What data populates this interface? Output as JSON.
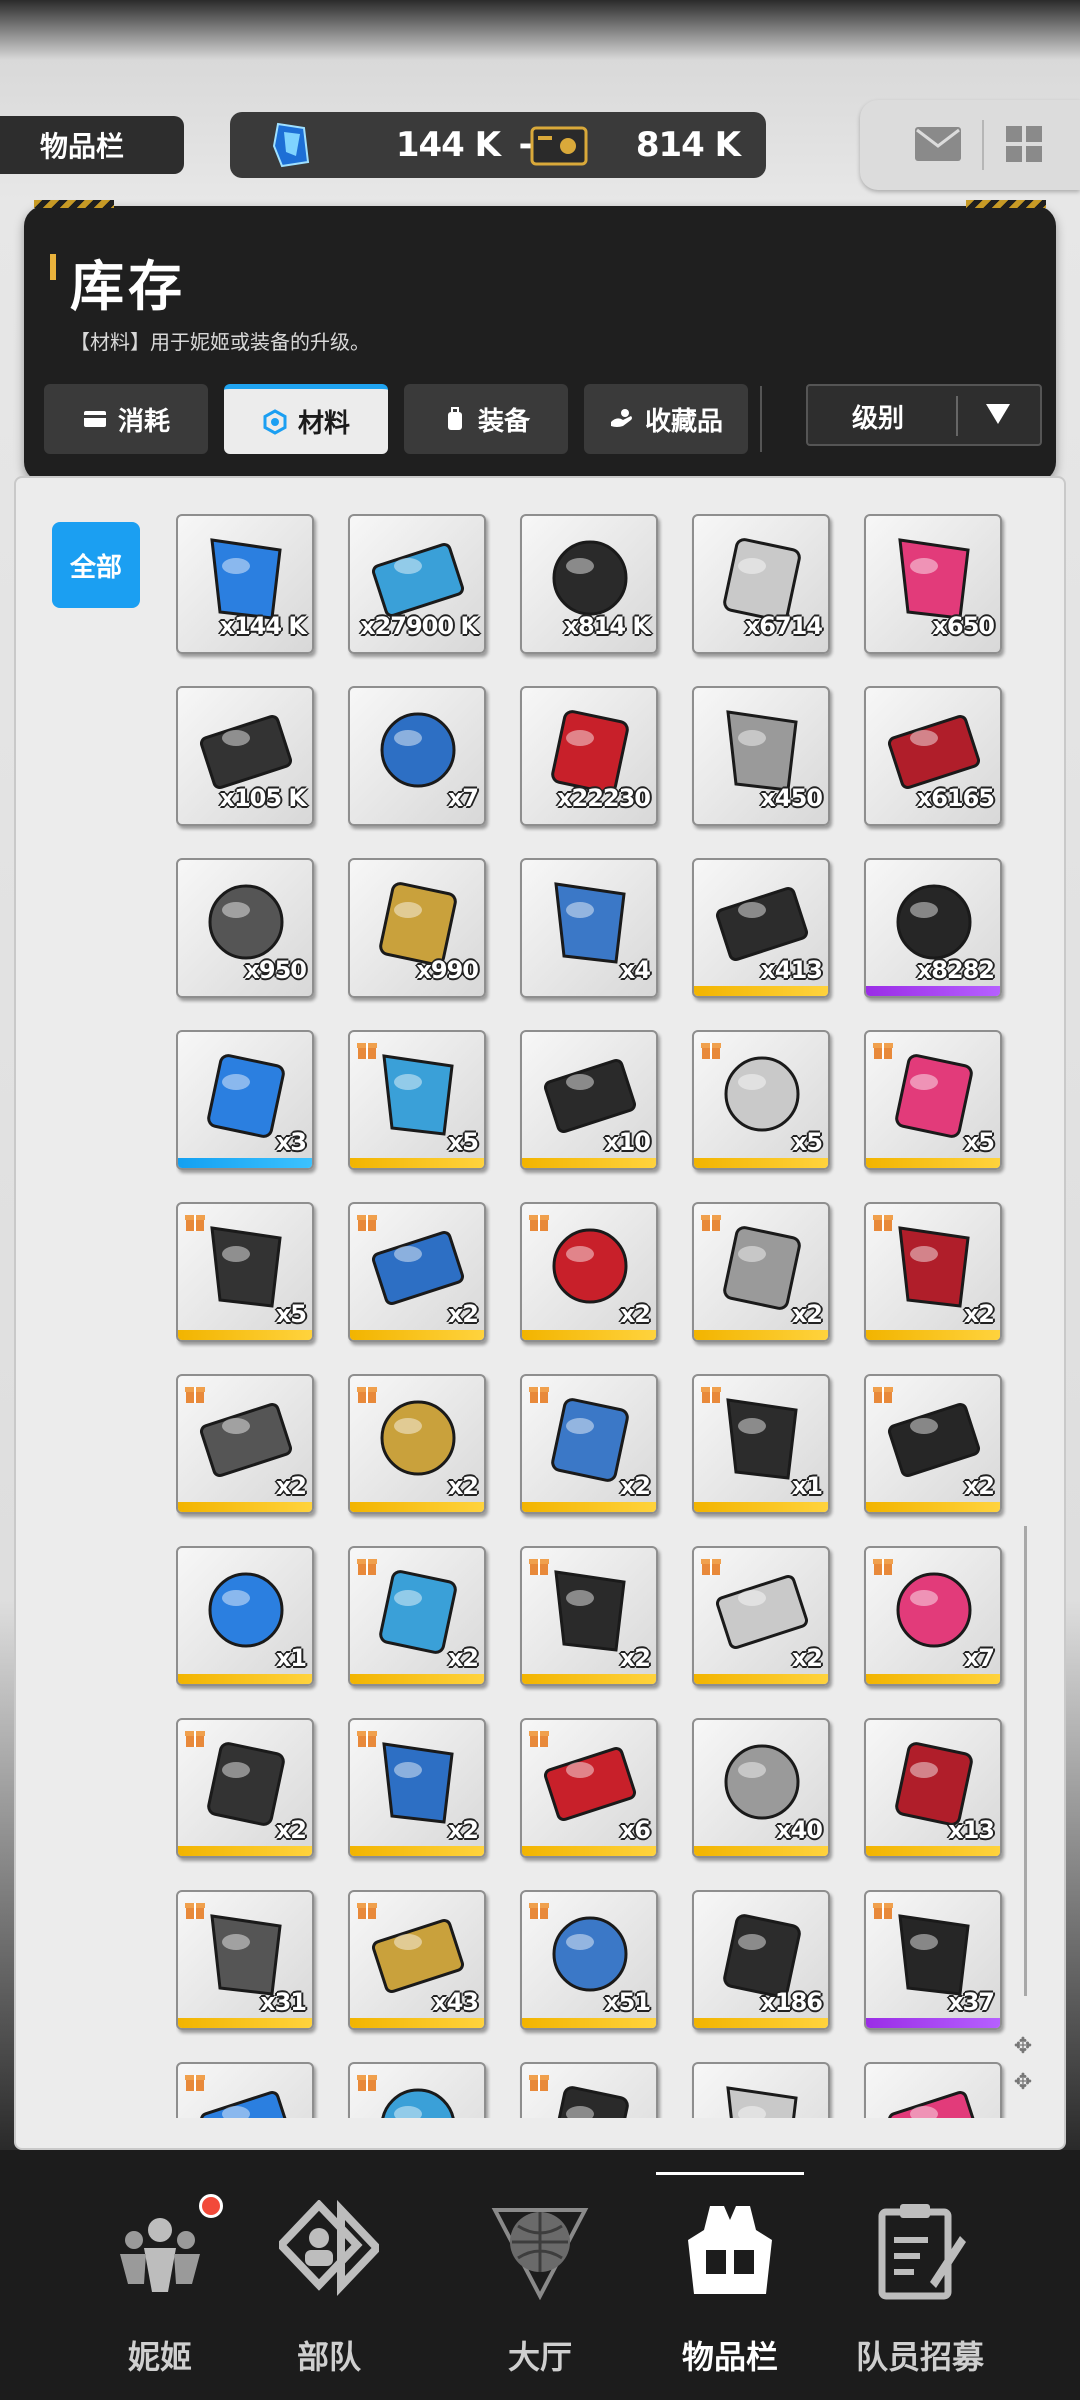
{
  "top": {
    "section_tag": "物品栏",
    "currency_gems": "144 K",
    "add_symbol": "+",
    "currency_credits": "814 K"
  },
  "header": {
    "title": "库存",
    "subtitle": "【材料】用于妮姬或装备的升级。",
    "tabs": [
      {
        "label": "消耗",
        "icon": "consumable-card-icon",
        "active": false
      },
      {
        "label": "材料",
        "icon": "hexagon-material-icon",
        "active": true
      },
      {
        "label": "装备",
        "icon": "backpack-equipment-icon",
        "active": false
      },
      {
        "label": "收藏品",
        "icon": "collectible-hand-icon",
        "active": false
      }
    ],
    "sort_label": "级别"
  },
  "filter_all": "全部",
  "items": [
    {
      "icon": "blue-gem-icon",
      "qty": "x144 K",
      "rarity": "none",
      "gift": false
    },
    {
      "icon": "usb-drive-icon",
      "qty": "x27900 K",
      "rarity": "none",
      "gift": false
    },
    {
      "icon": "credit-card-icon",
      "qty": "x814 K",
      "rarity": "none",
      "gift": false
    },
    {
      "icon": "robot-eye-orb-icon",
      "qty": "x6714",
      "rarity": "none",
      "gift": false
    },
    {
      "icon": "pink-heart-gem-icon",
      "qty": "x650",
      "rarity": "none",
      "gift": false
    },
    {
      "icon": "black-ticket-icon",
      "qty": "x105 K",
      "rarity": "none",
      "gift": false
    },
    {
      "icon": "blue-photo-card-icon",
      "qty": "x7",
      "rarity": "none",
      "gift": false
    },
    {
      "icon": "red-core-orb-icon",
      "qty": "x22230",
      "rarity": "none",
      "gift": false
    },
    {
      "icon": "dna-hexagon-token-icon",
      "qty": "x450",
      "rarity": "none",
      "gift": false
    },
    {
      "icon": "red-circuit-chip-icon",
      "qty": "x6165",
      "rarity": "none",
      "gift": false
    },
    {
      "icon": "silver-wing-card-icon",
      "qty": "x950",
      "rarity": "none",
      "gift": false
    },
    {
      "icon": "gold-wing-card-icon",
      "qty": "x990",
      "rarity": "none",
      "gift": false
    },
    {
      "icon": "lanyard-pass-icon",
      "qty": "x4",
      "rarity": "none",
      "gift": false
    },
    {
      "icon": "green-circuit-module-icon",
      "qty": "x413",
      "rarity": "gold",
      "gift": false
    },
    {
      "icon": "dark-module-icon",
      "qty": "x8282",
      "rarity": "purple",
      "gift": false
    },
    {
      "icon": "small-module-icon",
      "qty": "x3",
      "rarity": "blue",
      "gift": false
    },
    {
      "icon": "fox-plush-icon",
      "qty": "x5",
      "rarity": "gold",
      "gift": true
    },
    {
      "icon": "game-controller-icon",
      "qty": "x10",
      "rarity": "gold",
      "gift": false
    },
    {
      "icon": "fountain-pen-icon",
      "qty": "x5",
      "rarity": "gold",
      "gift": true
    },
    {
      "icon": "rabbit-card-icon",
      "qty": "x5",
      "rarity": "gold",
      "gift": true
    },
    {
      "icon": "star-plush-icon",
      "qty": "x5",
      "rarity": "gold",
      "gift": true
    },
    {
      "icon": "credits-voucher-icon",
      "qty": "x2",
      "rarity": "gold",
      "gift": true
    },
    {
      "icon": "energy-drink-can-icon",
      "qty": "x2",
      "rarity": "gold",
      "gift": true
    },
    {
      "icon": "ssd-drive-icon",
      "qty": "x2",
      "rarity": "gold",
      "gift": true
    },
    {
      "icon": "bronze-medal-icon",
      "qty": "x2",
      "rarity": "gold",
      "gift": true
    },
    {
      "icon": "wireless-charger-icon",
      "qty": "x2",
      "rarity": "gold",
      "gift": true
    },
    {
      "icon": "red-book-icon",
      "qty": "x2",
      "rarity": "gold",
      "gift": true
    },
    {
      "icon": "red-rope-icon",
      "qty": "x2",
      "rarity": "gold",
      "gift": true
    },
    {
      "icon": "sheet-music-icon",
      "qty": "x1",
      "rarity": "gold",
      "gift": true
    },
    {
      "icon": "coffee-sticks-icon",
      "qty": "x2",
      "rarity": "gold",
      "gift": true
    },
    {
      "icon": "stethoscope-icon",
      "qty": "x1",
      "rarity": "gold",
      "gift": false
    },
    {
      "icon": "multicolor-pen-icon",
      "qty": "x2",
      "rarity": "gold",
      "gift": true
    },
    {
      "icon": "car-battery-icon",
      "qty": "x2",
      "rarity": "gold",
      "gift": true
    },
    {
      "icon": "pet-food-bag-icon",
      "qty": "x2",
      "rarity": "gold",
      "gift": true
    },
    {
      "icon": "toy-train-icon",
      "qty": "x7",
      "rarity": "gold",
      "gift": true
    },
    {
      "icon": "cosmetic-pouch-icon",
      "qty": "x2",
      "rarity": "gold",
      "gift": true
    },
    {
      "icon": "walkie-talkie-icon",
      "qty": "x2",
      "rarity": "gold",
      "gift": true
    },
    {
      "icon": "water-bottles-icon",
      "qty": "x6",
      "rarity": "gold",
      "gift": true
    },
    {
      "icon": "blue-tour-ticket-icon",
      "qty": "x40",
      "rarity": "gold",
      "gift": false
    },
    {
      "icon": "purple-tour-ticket-icon",
      "qty": "x13",
      "rarity": "gold",
      "gift": false
    },
    {
      "icon": "vip-beauty-card-icon",
      "qty": "x31",
      "rarity": "gold",
      "gift": true
    },
    {
      "icon": "gold-vip-card-icon",
      "qty": "x43",
      "rarity": "gold",
      "gift": true
    },
    {
      "icon": "red-ticket-pack-icon",
      "qty": "x51",
      "rarity": "gold",
      "gift": true
    },
    {
      "icon": "mint-ticket-icon",
      "qty": "x186",
      "rarity": "gold",
      "gift": false
    },
    {
      "icon": "green-tour-ticket-icon",
      "qty": "x37",
      "rarity": "purple",
      "gift": true
    },
    {
      "icon": "pink-ticket-icon",
      "qty": "",
      "rarity": "gold",
      "gift": true
    },
    {
      "icon": "day-pass-card-icon",
      "qty": "",
      "rarity": "gold",
      "gift": true
    },
    {
      "icon": "peach-ticket-icon",
      "qty": "",
      "rarity": "gold",
      "gift": true
    },
    {
      "icon": "cyan-device-icon",
      "qty": "",
      "rarity": "gold",
      "gift": false
    },
    {
      "icon": "dark-canister-icon",
      "qty": "",
      "rarity": "gold",
      "gift": false
    }
  ],
  "nav": [
    {
      "label": "妮姬",
      "icon": "nikke-group-icon",
      "active": false,
      "badge": true
    },
    {
      "label": "部队",
      "icon": "squad-diamond-icon",
      "active": false,
      "badge": false
    },
    {
      "label": "大厅",
      "icon": "lobby-dome-icon",
      "active": false,
      "badge": false
    },
    {
      "label": "物品栏",
      "icon": "inventory-vest-icon",
      "active": true,
      "badge": false
    },
    {
      "label": "队员招募",
      "icon": "recruit-clipboard-icon",
      "active": false,
      "badge": false
    }
  ],
  "colors": {
    "accent_blue": "#1b9ff2",
    "rarity_gold": "#f2b400",
    "rarity_purple": "#9a2de6",
    "rarity_blue": "#13a0f1",
    "notification_red": "#f24a3a"
  }
}
